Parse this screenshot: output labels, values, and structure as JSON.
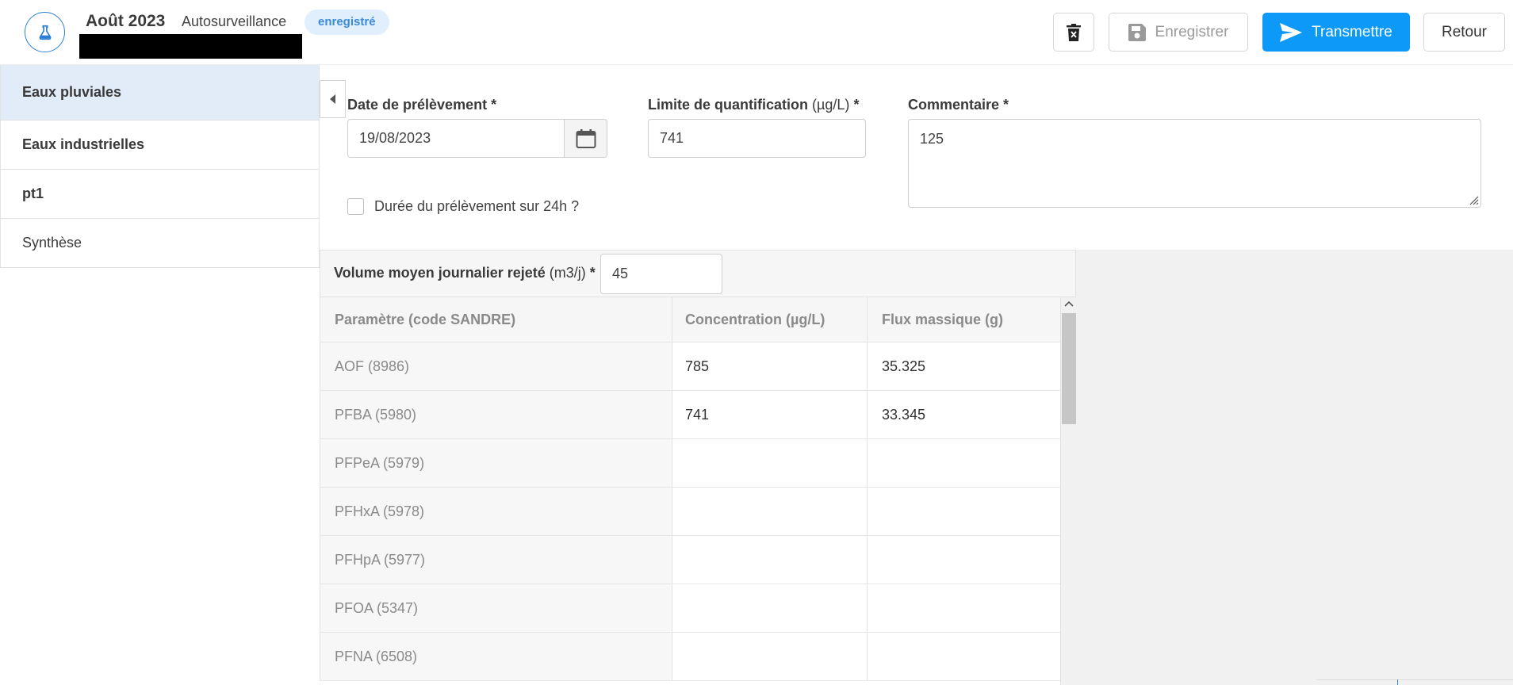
{
  "header": {
    "month": "Août 2023",
    "type": "Autosurveillance",
    "status": "enregistré",
    "save_label": "Enregistrer",
    "send_label": "Transmettre",
    "back_label": "Retour"
  },
  "sidebar": {
    "items": [
      {
        "label": "Eaux pluviales"
      },
      {
        "label": "Eaux industrielles"
      },
      {
        "label": "pt1"
      },
      {
        "label": "Synthèse"
      }
    ]
  },
  "form": {
    "date_label": "Date de prélèvement",
    "date_value": "19/08/2023",
    "limit_label": "Limite de quantification",
    "limit_unit": "(µg/L)",
    "limit_value": "741",
    "comment_label": "Commentaire",
    "comment_value": "125",
    "required_mark": "*",
    "duration_label": "Durée du prélèvement sur 24h ?",
    "volume_label": "Volume moyen journalier rejeté",
    "volume_unit": "(m3/j)",
    "volume_value": "45"
  },
  "table": {
    "headers": [
      "Paramètre (code SANDRE)",
      "Concentration (µg/L)",
      "Flux massique (g)"
    ],
    "rows": [
      {
        "param": "AOF (8986)",
        "conc": "785",
        "flux": "35.325"
      },
      {
        "param": "PFBA (5980)",
        "conc": "741",
        "flux": "33.345"
      },
      {
        "param": "PFPeA (5979)",
        "conc": "",
        "flux": ""
      },
      {
        "param": "PFHxA (5978)",
        "conc": "",
        "flux": ""
      },
      {
        "param": "PFHpA (5977)",
        "conc": "",
        "flux": ""
      },
      {
        "param": "PFOA (5347)",
        "conc": "",
        "flux": ""
      },
      {
        "param": "PFNA (6508)",
        "conc": "",
        "flux": ""
      }
    ]
  },
  "colors": {
    "primary": "#0d99f7",
    "badge_bg": "#e1eefb",
    "active_item_bg": "#e2ecf8"
  },
  "icons": {
    "logo": "flask-icon",
    "delete": "trash-icon",
    "save": "floppy-disk-icon",
    "send": "paper-plane-icon",
    "collapse": "caret-left-icon",
    "calendar": "calendar-icon"
  }
}
